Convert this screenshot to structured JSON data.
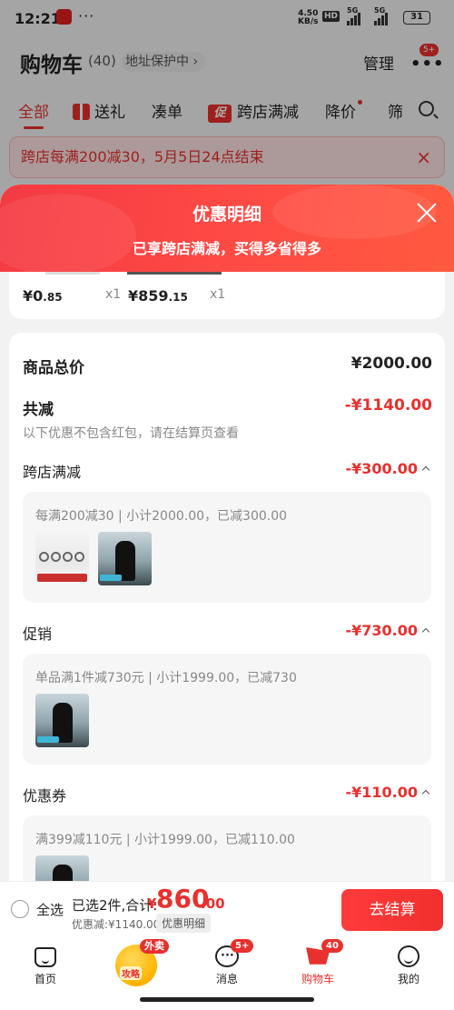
{
  "status_bar": {
    "time": "12:21",
    "dots": "···",
    "net_speed_value": "4.50",
    "net_speed_unit": "KB/s",
    "hd": "HD",
    "sig1": "5G",
    "sig2": "5G",
    "battery": "31"
  },
  "header": {
    "title": "购物车",
    "count": "(40)",
    "address_label": "地址保护中 ›",
    "manage": "管理",
    "more_badge": "5+"
  },
  "tabs": [
    {
      "label": "全部",
      "active": true
    },
    {
      "label": "送礼"
    },
    {
      "label": "凑单"
    },
    {
      "label": "跨店满减",
      "icon_text": "促"
    },
    {
      "label": "降价"
    },
    {
      "label": "筛"
    }
  ],
  "banner": {
    "text": "跨店每满200减30，5月5日24点结束",
    "close": "×"
  },
  "sheet": {
    "title": "优惠明细",
    "subtitle": "已享跨店满减，买得多省得多",
    "items": [
      {
        "currency": "¥",
        "price_int": "0",
        "price_dec": ".85",
        "qty": "x1"
      },
      {
        "currency": "¥",
        "price_int": "859",
        "price_dec": ".15",
        "qty": "x1"
      }
    ],
    "total_label": "商品总价",
    "total_value": "¥2000.00",
    "reduce_label": "共减",
    "reduce_value": "-¥1140.00",
    "reduce_note": "以下优惠不包含红包，请在结算页查看",
    "sections": [
      {
        "label": "跨店满减",
        "value": "-¥300.00",
        "rule": "每满200减30 | 小计2000.00，已减300.00"
      },
      {
        "label": "促销",
        "value": "-¥730.00",
        "rule": "单品满1件减730元 | 小计1999.00，已减730"
      },
      {
        "label": "优惠券",
        "value": "-¥110.00",
        "rule": "满399减110元 | 小计1999.00，已减110.00"
      }
    ]
  },
  "checkout": {
    "select_all": "全选",
    "summary_label": "已选2件,合计:",
    "currency": "¥",
    "amount_int": "860",
    "amount_dec": ".00",
    "discount": "优惠减:¥1140.00",
    "detail_tag": "优惠明细",
    "button": "去结算"
  },
  "tabbar": {
    "home": "首页",
    "center_text": "攻略",
    "center_tag": "外卖",
    "messages": "消息",
    "messages_badge": "5+",
    "cart": "购物车",
    "cart_badge": "40",
    "me": "我的"
  },
  "colors": {
    "accent": "#e8302e",
    "sheet_header": "#ff4b45"
  }
}
